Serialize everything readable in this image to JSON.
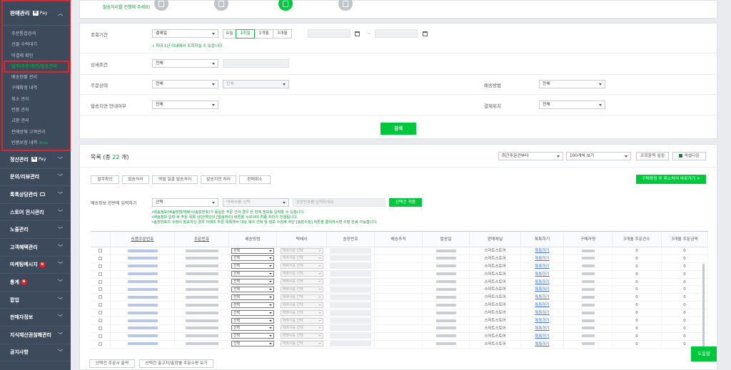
{
  "sidebar": {
    "open_group": {
      "title": "판매관리",
      "pay_badge": "N",
      "pay_text": "Pay",
      "items": [
        "주문통합검색",
        "선물 수락대기",
        "미결제 확인",
        "발주(주문)확인/발송관리",
        "배송현황 관리",
        "구매확정 내역",
        "취소 관리",
        "반품 관리",
        "교환 관리",
        "판매방해 고객관리",
        "반품보험 내역"
      ],
      "beta_label": "Beta"
    },
    "groups": [
      {
        "label": "정산관리",
        "pay_text": "Pay"
      },
      {
        "label": "문의/리뷰관리"
      },
      {
        "label": "톡톡상담관리"
      },
      {
        "label": "스토어 전시관리"
      },
      {
        "label": "노출관리"
      },
      {
        "label": "고객혜택관리"
      },
      {
        "label": "마케팅메시지",
        "badge": "N"
      },
      {
        "label": "통계",
        "badge": "N"
      },
      {
        "label": "팝업"
      },
      {
        "label": "판매자정보"
      },
      {
        "label": "지식재산권침해관리"
      },
      {
        "label": "공지사항"
      }
    ]
  },
  "top": {
    "note": "발송처리를 진행해 주세요!"
  },
  "search": {
    "period_label": "조회기간",
    "period_type": "결제일",
    "range_buttons": [
      "오늘",
      "1주일",
      "1개월",
      "3개월"
    ],
    "range_selected": "1주일",
    "range_note": "• 최대 1년 이내에서 조회하실 수 있습니다.",
    "detail_label": "상세조건",
    "detail_value": "전체",
    "status_label": "주문상태",
    "status_value": "전체",
    "status_sub": "전체",
    "ship_method_label": "배송방법",
    "ship_method_value": "전체",
    "delay_label": "발송지연 안내여부",
    "delay_value": "전체",
    "pay_place_label": "결제위치",
    "pay_place_value": "전체",
    "search_button": "검색"
  },
  "list": {
    "title_prefix": "목록 (총 ",
    "count": "22",
    "title_suffix": " 개)",
    "sort_value": "최근주문건부터",
    "page_size": "100개씩 보기",
    "column_setting": "조회항목 설정",
    "excel": "엑셀다운",
    "actions": [
      "발주확인",
      "발송처리",
      "엑셀 일괄 발송처리",
      "발송지연 처리",
      "판매취소"
    ],
    "right_action": "구매확정 후 취소처리 바로가기 >",
    "ship_info_label": "배송정보 한번에 입력하기",
    "ship_info_select": "선택",
    "courier_placeholder": "택배사를 선택",
    "tracking_placeholder": "송장번호를 입력하세요",
    "apply_button": "선택건 적용",
    "info_lines": [
      "•배송정보(배송방법/택배사/송장번호)가 동일한 주문 건의 경우 한 번에 정보를 입력할 수 있습니다.",
      "•배송정보 입력 후 주문 목록 상단/하단의 [발송처리] 버튼을 누르셔야 최종 처리가 진행됩니다.",
      "•송장번호의 수정이 필요하신 경우 아래의 주문 목록에서 대상 체크 선택 및 정보 수정후 하단 [송장수정] 버튼을 클릭하시면 수정 완료 가능합니다."
    ],
    "columns": [
      "",
      "상품주문번호",
      "주문번호",
      "배송방법",
      "택배사",
      "송장번호",
      "배송추적",
      "발송일",
      "판매채널",
      "톡톡하기",
      "구매자명",
      "3개월 주문건수",
      "3개월 주문금액"
    ],
    "row_defaults": {
      "ship_method": "선택",
      "courier": "택배사를 선택",
      "channel": "스마트스토어",
      "talk": "톡톡하기",
      "count3m": "0",
      "amount3m": "0"
    },
    "row_count": 13,
    "bottom_buttons": [
      "선택건 주문서 출력",
      "선택건 출고지/출장별 주문수량 보기"
    ],
    "help_button": "도움말"
  }
}
